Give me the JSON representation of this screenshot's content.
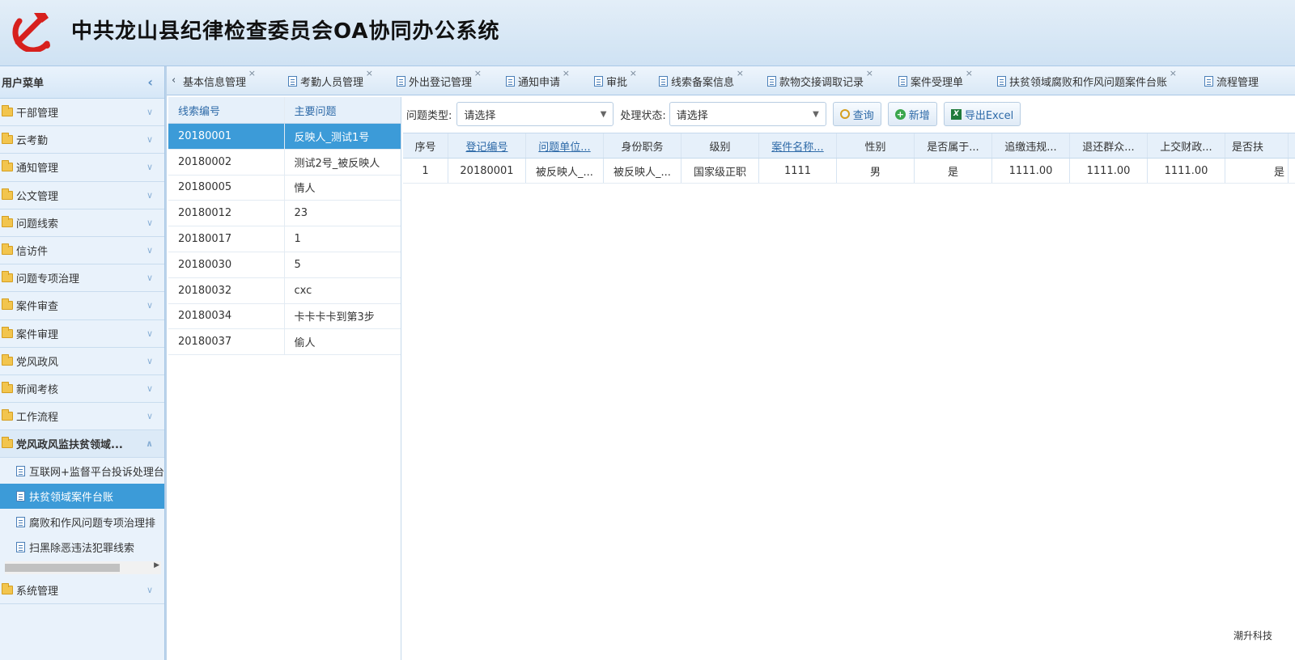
{
  "app": {
    "title": "中共龙山县纪律检查委员会OA协同办公系统",
    "footer": "潮升科技"
  },
  "sidebar": {
    "title": "用户菜单",
    "items": [
      {
        "label": "干部管理"
      },
      {
        "label": "云考勤"
      },
      {
        "label": "通知管理"
      },
      {
        "label": "公文管理"
      },
      {
        "label": "问题线索"
      },
      {
        "label": "信访件"
      },
      {
        "label": "问题专项治理"
      },
      {
        "label": "案件审查"
      },
      {
        "label": "案件审理"
      },
      {
        "label": "党风政风"
      },
      {
        "label": "新闻考核"
      },
      {
        "label": "工作流程"
      },
      {
        "label": "党风政风监扶贫领域..."
      }
    ],
    "subitems": [
      {
        "label": "互联网+监督平台投诉处理台"
      },
      {
        "label": "扶贫领域案件台账"
      },
      {
        "label": "腐败和作风问题专项治理排"
      },
      {
        "label": "扫黑除恶违法犯罪线索"
      }
    ],
    "last_item": "系统管理"
  },
  "tabs": [
    {
      "label": "基本信息管理"
    },
    {
      "label": "考勤人员管理"
    },
    {
      "label": "外出登记管理"
    },
    {
      "label": "通知申请"
    },
    {
      "label": "审批"
    },
    {
      "label": "线索备案信息"
    },
    {
      "label": "款物交接调取记录"
    },
    {
      "label": "案件受理单"
    },
    {
      "label": "扶贫领域腐败和作风问题案件台账"
    },
    {
      "label": "流程管理"
    }
  ],
  "clue_list": {
    "headers": [
      "线索编号",
      "主要问题"
    ],
    "rows": [
      [
        "20180001",
        "反映人_测试1号"
      ],
      [
        "20180002",
        "测试2号_被反映人"
      ],
      [
        "20180005",
        "情人"
      ],
      [
        "20180012",
        "23"
      ],
      [
        "20180017",
        "1"
      ],
      [
        "20180030",
        "5"
      ],
      [
        "20180032",
        "cxc"
      ],
      [
        "20180034",
        "卡卡卡卡到第3步"
      ],
      [
        "20180037",
        "偷人"
      ]
    ]
  },
  "toolbar": {
    "type_label": "问题类型:",
    "type_value": "请选择",
    "status_label": "处理状态:",
    "status_value": "请选择",
    "query": "查询",
    "add": "新增",
    "export": "导出Excel"
  },
  "grid": {
    "headers": [
      "序号",
      "登记编号",
      "问题单位...",
      "身份职务",
      "级别",
      "案件名称...",
      "性别",
      "是否属于...",
      "追缴违规...",
      "退还群众...",
      "上交财政...",
      "是否扶"
    ],
    "rows": [
      [
        "1",
        "20180001",
        "被反映人_...",
        "被反映人_...",
        "国家级正职",
        "1111",
        "男",
        "是",
        "1111.00",
        "1111.00",
        "1111.00",
        "是"
      ]
    ]
  }
}
